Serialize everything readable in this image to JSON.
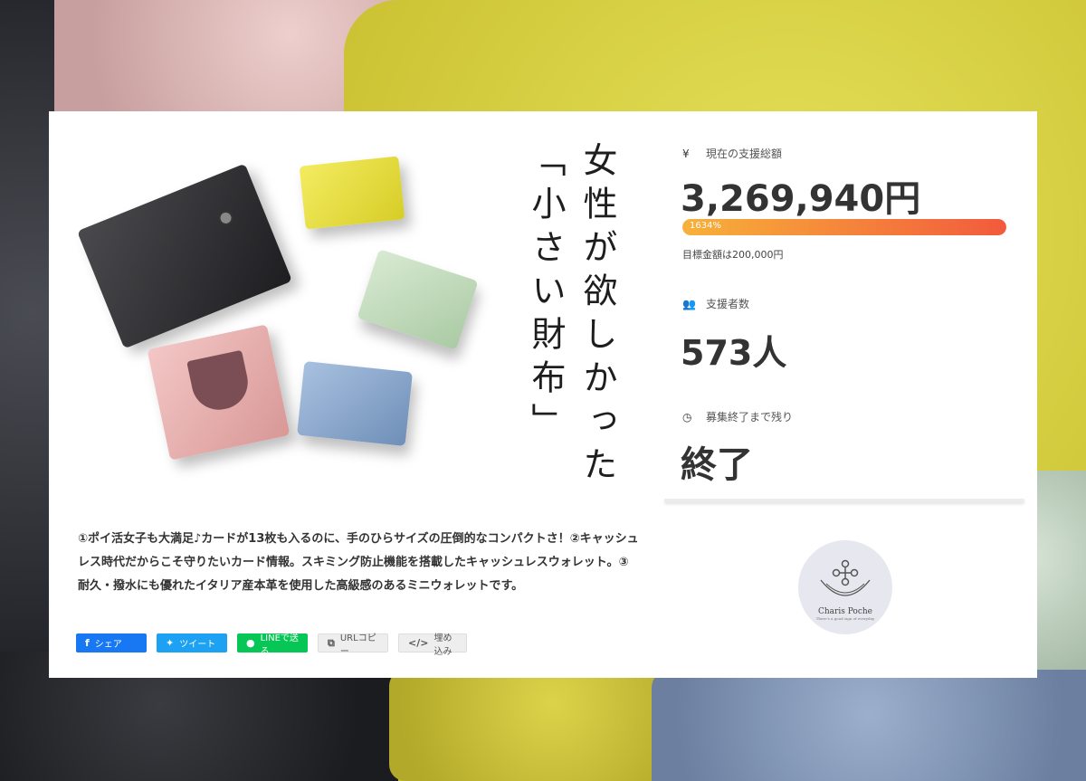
{
  "project": {
    "title_vertical": "女性が欲しかった「小さい財布」",
    "description": "①ポイ活女子も大満足♪カードが13枚も入るのに、手のひらサイズの圧倒的なコンパクトさ！②キャッシュレス時代だからこそ守りたいカード情報。スキミング防止機能を搭載したキャッシュレスウォレット。③耐久・撥水にも優れたイタリア産本革を使用した高級感のあるミニウォレットです。"
  },
  "share": {
    "facebook_label": "シェア",
    "twitter_label": "ツイート",
    "line_label": "LINEで送る",
    "url_copy_label": "URLコピー",
    "embed_label": "埋め込み",
    "icons": {
      "facebook": "facebook-icon",
      "twitter": "twitter-icon",
      "line": "line-icon",
      "copy": "copy-icon",
      "embed": "code-icon"
    }
  },
  "stats": {
    "amount_label": "現在の支援総額",
    "amount_value": "3,269,940円",
    "progress_text": "1634%",
    "progress_fraction": 1.0,
    "goal_text": "目標金額は200,000円",
    "backers_label": "支援者数",
    "backers_value": "573人",
    "remaining_label": "募集終了まで残り",
    "remaining_value": "終了",
    "icons": {
      "amount": "yen-icon",
      "backers": "users-icon",
      "remaining": "clock-icon"
    },
    "progress_colors": [
      "#f7b13a",
      "#f25a3c"
    ]
  },
  "brand": {
    "name": "Charis Poche",
    "tagline": "There's a good sign of everyday"
  }
}
